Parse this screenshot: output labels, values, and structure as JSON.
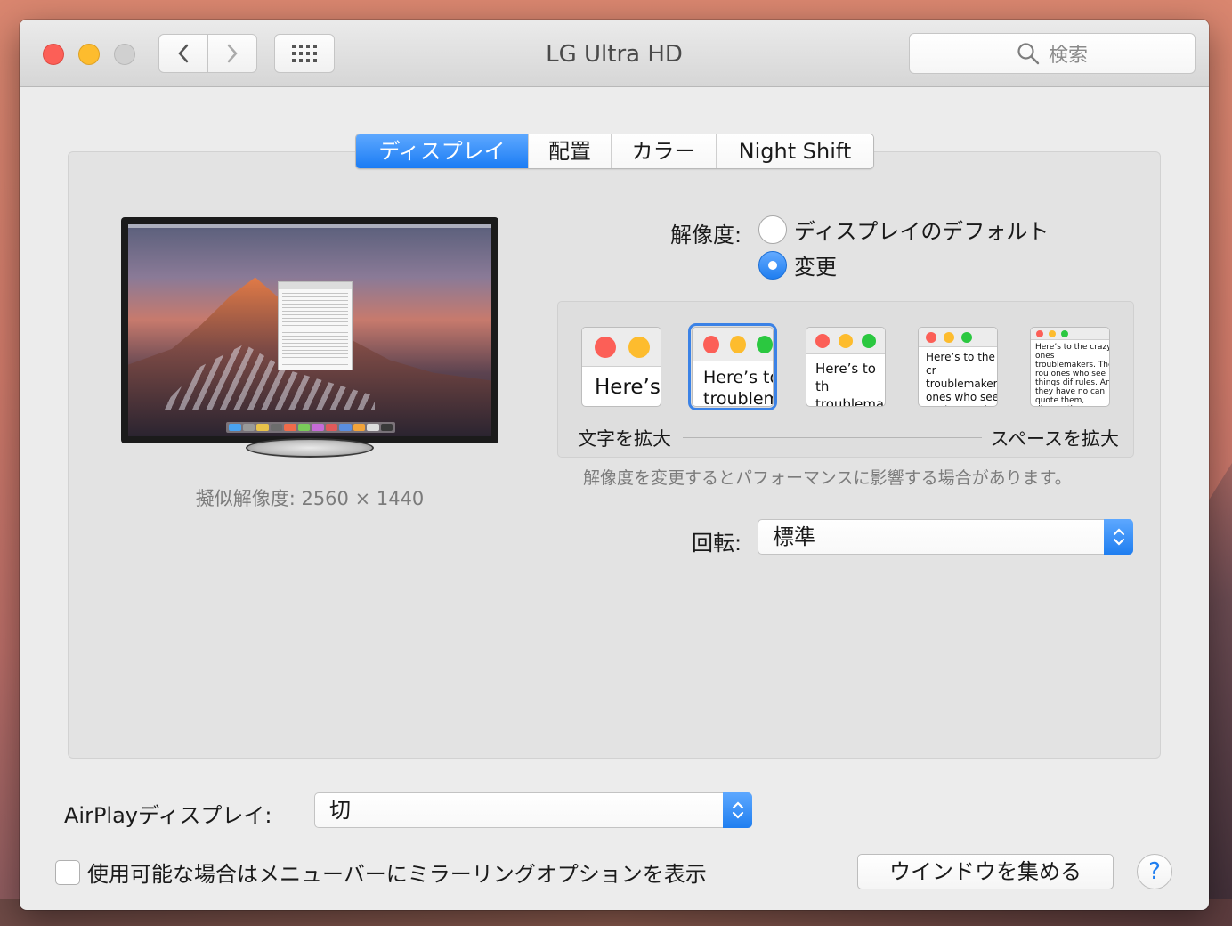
{
  "window": {
    "title": "LG Ultra HD",
    "search_placeholder": "検索"
  },
  "tabs": [
    {
      "label": "ディスプレイ",
      "active": true
    },
    {
      "label": "配置",
      "active": false
    },
    {
      "label": "カラー",
      "active": false
    },
    {
      "label": "Night Shift",
      "active": false
    }
  ],
  "display": {
    "scaled_resolution": "擬似解像度: 2560 × 1440",
    "resolution_label": "解像度:",
    "options": [
      {
        "label": "ディスプレイのデフォルト",
        "selected": false
      },
      {
        "label": "変更",
        "selected": true
      }
    ],
    "scale_previews": [
      {
        "text": "Here’s",
        "selected": false
      },
      {
        "text": "Here’s to troublem",
        "selected": true
      },
      {
        "text": "Here’s to th troublemak ones who",
        "selected": false
      },
      {
        "text": "Here’s to the cr troublemakers. ones who see t rules. And they",
        "selected": false
      },
      {
        "text": "Here’s to the crazy ones troublemakers. The rou ones who see things dif rules. And they have no can quote them, disagre them. About the only th Because they change t",
        "selected": false
      }
    ],
    "scale_left": "文字を拡大",
    "scale_right": "スペースを拡大",
    "performance_note": "解像度を変更するとパフォーマンスに影響する場合があります。",
    "rotation_label": "回転:",
    "rotation_value": "標準"
  },
  "airplay": {
    "label": "AirPlayディスプレイ:",
    "value": "切"
  },
  "mirroring_checkbox": {
    "label": "使用可能な場合はメニューバーにミラーリングオプションを表示",
    "checked": false
  },
  "gather_windows_label": "ウインドウを集める",
  "help_label": "?",
  "colors": {
    "accent": "#1f7ef0",
    "close": "#fc5f57",
    "minimize": "#fdbc2e",
    "maximize_disabled": "#d0d0d0",
    "dot_green": "#2bc840"
  }
}
